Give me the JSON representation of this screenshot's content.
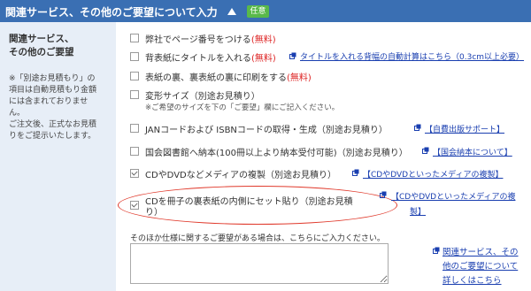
{
  "header": {
    "title": "関連サービス、その他のご要望について入力",
    "badge": "任意"
  },
  "left_panel": {
    "title": "関連サービス、\nその他のご要望",
    "note": "※「別途お見積もり」の\n項目は自動見積もり金額\nには含まれておりませ\nん。\nご注文後、正式なお見積\nりをご提示いたします。"
  },
  "options": [
    {
      "label": "弊社でページ番号をつける",
      "price": "(無料)",
      "checked": false
    },
    {
      "label": "背表紙にタイトルを入れる",
      "price": "(無料)",
      "checked": false,
      "link": "タイトルを入れる背幅の自動計算はこちら（0.3cm以上必要）"
    },
    {
      "label": "表紙の裏、裏表紙の裏に印刷をする",
      "price": "(無料)",
      "checked": false
    },
    {
      "label": "変形サイズ（別途お見積り）",
      "checked": false,
      "sub": "※ご希望のサイズを下の「ご要望」欄にご記入ください。"
    },
    {
      "label": "JANコードおよび ISBNコードの取得・生成（別途お見積り）",
      "checked": false,
      "link": "【自費出版サポート】"
    },
    {
      "label": "国会図書館へ納本(100冊以上より納本受付可能)（別途お見積り）",
      "checked": false,
      "link": "【国会納本について】"
    },
    {
      "label": "CDやDVDなどメディアの複製（別途お見積り）",
      "checked": true,
      "link": "【CDやDVDといったメディアの複製】"
    },
    {
      "label_line1": "CDを冊子の裏表紙の内側にセット貼り（別途お見積",
      "label_line2": "り）",
      "checked": true,
      "link_line1": "【CDやDVDといったメディアの複",
      "link_line2": "製】"
    }
  ],
  "request": {
    "prompt": "そのほか仕様に関するご要望がある場合は、こちらにご入力ください。",
    "value": ""
  },
  "side_link": {
    "line1": "関連サービス、その",
    "line2": "他のご要望について",
    "line3": "詳しくはこちら"
  },
  "colors": {
    "header_bg": "#3a6fb3",
    "badge_bg": "#59b94a",
    "left_bg": "#e7eef7",
    "link": "#1a3fb0",
    "price_red": "#dd2222",
    "highlight_oval": "#e0392b"
  }
}
